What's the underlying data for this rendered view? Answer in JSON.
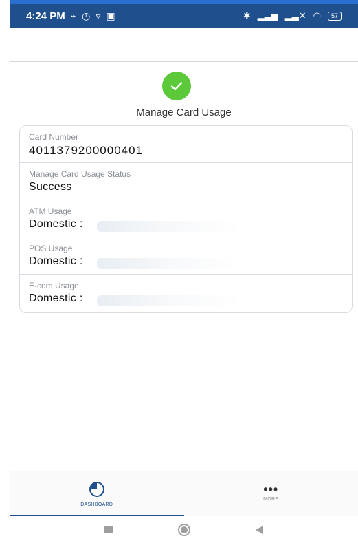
{
  "status_bar": {
    "time": "4:24 PM",
    "battery": "57"
  },
  "page": {
    "title": "Manage Card Usage"
  },
  "details": [
    {
      "label": "Card Number",
      "value": "4011379200000401"
    },
    {
      "label": "Manage Card Usage Status",
      "value": "Success"
    },
    {
      "label": "ATM Usage",
      "value": "Domestic :"
    },
    {
      "label": "POS Usage",
      "value": "Domestic :"
    },
    {
      "label": "E-com Usage",
      "value": "Domestic :"
    }
  ],
  "bottom_nav": {
    "dashboard_label": "DASHBOARD",
    "more_label": "MORE"
  },
  "colors": {
    "status_bar": "#1f4f8c",
    "success": "#5cc93a",
    "accent": "#1f4f8c"
  },
  "icons": [
    "success-check-icon",
    "dashboard-pie-icon",
    "more-dots-icon",
    "wifi-icon",
    "bluetooth-icon",
    "battery-icon"
  ]
}
